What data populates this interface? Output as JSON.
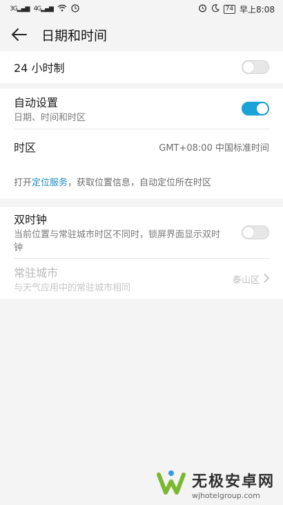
{
  "status_bar": {
    "signal1": "3G",
    "signal2": "4G",
    "battery": "74",
    "time": "早上8:08"
  },
  "header": {
    "title": "日期和时间"
  },
  "settings": {
    "hour24": {
      "label": "24 小时制",
      "enabled": false
    },
    "auto": {
      "label": "自动设置",
      "sub": "日期、时间和时区",
      "enabled": true
    },
    "timezone": {
      "label": "时区",
      "value": "GMT+08:00 中国标准时间"
    },
    "note": {
      "prefix": "打开",
      "link": "定位服务",
      "suffix": "，获取位置信息，自动定位所在时区"
    },
    "dual": {
      "label": "双时钟",
      "sub": "当前位置与常驻城市时区不同时，锁屏界面显示双时钟",
      "enabled": false
    },
    "home_city": {
      "label": "常驻城市",
      "sub": "与天气应用中的常驻城市相同",
      "value": "泰山区"
    }
  },
  "watermark": {
    "cn": "无极安卓网",
    "en": "wjhotelgroup.com"
  },
  "colors": {
    "accent": "#1aa3d6",
    "link": "#1a8ac2"
  },
  "icons": [
    "back-arrow-icon",
    "alarm-icon",
    "moon-icon",
    "wifi-icon",
    "chevron-right-icon"
  ]
}
